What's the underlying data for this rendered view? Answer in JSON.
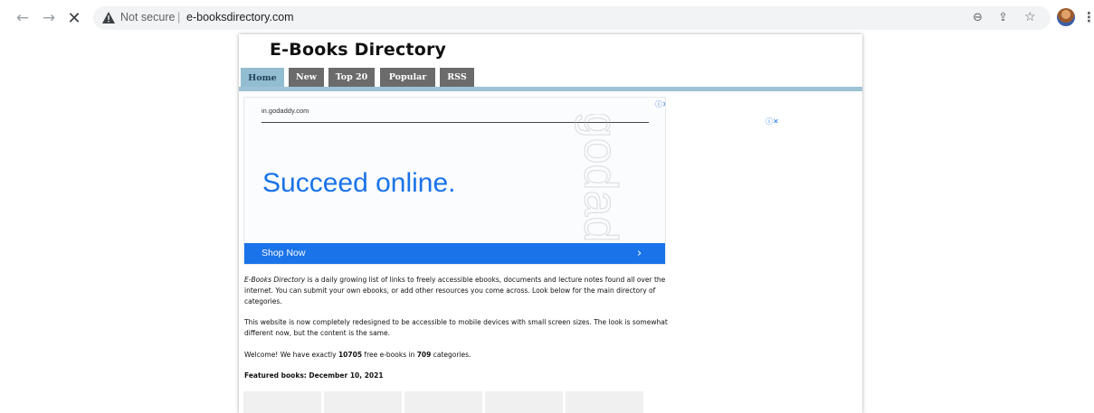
{
  "browser": {
    "security_label": "Not secure",
    "separator": "|",
    "url": "e-booksdirectory.com",
    "icons": [
      "back-arrow-icon",
      "forward-arrow-icon",
      "stop-icon",
      "warning-icon",
      "zoom-icon",
      "share-icon",
      "star-icon",
      "profile-avatar",
      "menu-icon"
    ]
  },
  "site": {
    "title": "E-Books Directory",
    "tabs": [
      {
        "label": "Home",
        "active": true
      },
      {
        "label": "New",
        "active": false
      },
      {
        "label": "Top 20",
        "active": false
      },
      {
        "label": "Popular",
        "active": false
      },
      {
        "label": "RSS",
        "active": false
      }
    ]
  },
  "ad": {
    "domain": "in.godaddy.com",
    "headline": "Succeed online.",
    "watermark": "in.godaddy",
    "cta": "Shop Now",
    "cta_arrow": "›",
    "choices": "ⓘ✕"
  },
  "side_ad": {
    "choices": "ⓘ✕"
  },
  "content": {
    "intro_em": "E-Books Directory",
    "intro_rest": " is a daily growing list of links to freely accessible ebooks, documents and lecture notes found all over the internet. You can submit your own ebooks, or add other resources you come across. Look below for the main directory of categories.",
    "redesign": "This website is now completely redesigned to be accessible to mobile devices with small screen sizes. The look is somewhat different now, but the content is the same.",
    "welcome_pre": "Welcome! We have exactly ",
    "book_count": "10705",
    "welcome_mid": " free e-books in ",
    "category_count": "709",
    "welcome_post": " categories.",
    "featured": "Featured books: December 10, 2021"
  },
  "colors": {
    "accent_blue": "#1a73e8",
    "tab_active": "#93bdd0",
    "tab_inactive": "#6b6b6b"
  }
}
